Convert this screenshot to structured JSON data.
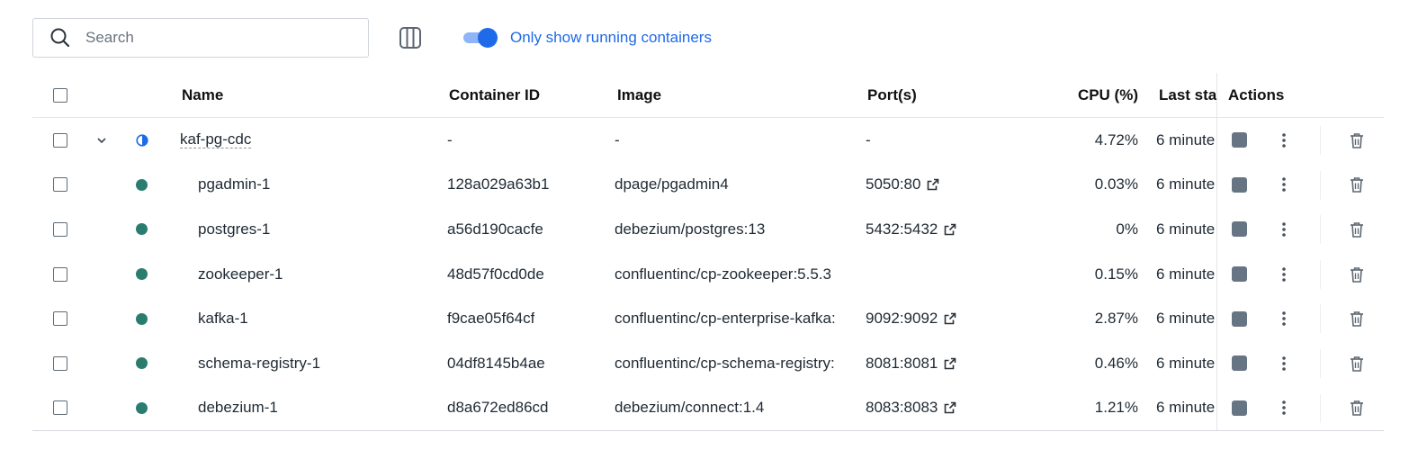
{
  "search": {
    "placeholder": "Search"
  },
  "filter": {
    "toggle_label": "Only show running containers",
    "enabled": true
  },
  "columns": {
    "name": "Name",
    "container_id": "Container ID",
    "image": "Image",
    "ports": "Port(s)",
    "cpu": "CPU (%)",
    "last_started": "Last sta",
    "actions": "Actions"
  },
  "group": {
    "name": "kaf-pg-cdc",
    "container_id": "-",
    "image": "-",
    "ports": "-",
    "cpu": "4.72%",
    "last_started": "6 minute"
  },
  "containers": [
    {
      "name": "pgadmin-1",
      "container_id": "128a029a63b1",
      "image": "dpage/pgadmin4",
      "ports": "5050:80",
      "cpu": "0.03%",
      "last_started": "6 minute"
    },
    {
      "name": "postgres-1",
      "container_id": "a56d190cacfe",
      "image": "debezium/postgres:13",
      "ports": "5432:5432",
      "cpu": "0%",
      "last_started": "6 minute"
    },
    {
      "name": "zookeeper-1",
      "container_id": "48d57f0cd0de",
      "image": "confluentinc/cp-zookeeper:5.5.3",
      "ports": "",
      "cpu": "0.15%",
      "last_started": "6 minute"
    },
    {
      "name": "kafka-1",
      "container_id": "f9cae05f64cf",
      "image": "confluentinc/cp-enterprise-kafka:",
      "ports": "9092:9092",
      "cpu": "2.87%",
      "last_started": "6 minute"
    },
    {
      "name": "schema-registry-1",
      "container_id": "04df8145b4ae",
      "image": "confluentinc/cp-schema-registry:",
      "ports": "8081:8081",
      "cpu": "0.46%",
      "last_started": "6 minute"
    },
    {
      "name": "debezium-1",
      "container_id": "d8a672ed86cd",
      "image": "debezium/connect:1.4",
      "ports": "8083:8083",
      "cpu": "1.21%",
      "last_started": "6 minute"
    }
  ],
  "colors": {
    "accent": "#1f6ae8",
    "running": "#2a7d6e",
    "stop_button": "#677483"
  }
}
